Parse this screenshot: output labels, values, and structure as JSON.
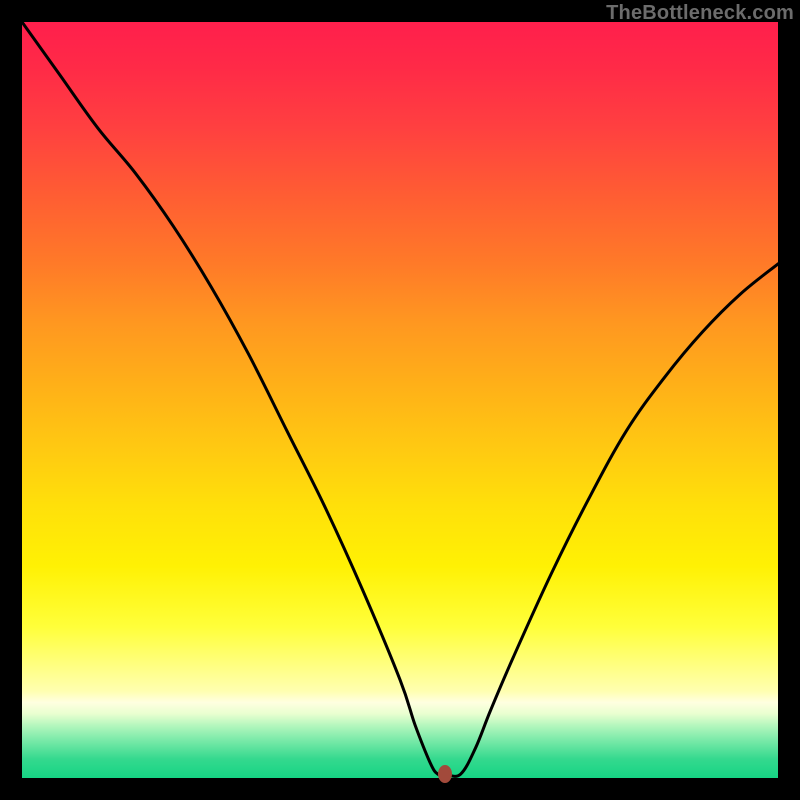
{
  "watermark": "TheBottleneck.com",
  "colors": {
    "frame": "#000000",
    "curve": "#000000",
    "marker": "#a24a3b",
    "gradient_top": "#ff1f4c",
    "gradient_bottom": "#16d484"
  },
  "chart_data": {
    "type": "line",
    "title": "",
    "xlabel": "",
    "ylabel": "",
    "xlim": [
      0,
      100
    ],
    "ylim": [
      0,
      100
    ],
    "grid": false,
    "legend": false,
    "series": [
      {
        "name": "bottleneck-curve",
        "x": [
          0,
          5,
          10,
          15,
          20,
          25,
          30,
          35,
          40,
          45,
          50,
          52,
          54,
          55,
          56,
          58,
          60,
          62,
          65,
          70,
          75,
          80,
          85,
          90,
          95,
          100
        ],
        "y": [
          100,
          93,
          86,
          80,
          73,
          65,
          56,
          46,
          36,
          25,
          13,
          7,
          2,
          0.5,
          0.5,
          0.5,
          4,
          9,
          16,
          27,
          37,
          46,
          53,
          59,
          64,
          68
        ]
      }
    ],
    "annotations": [
      {
        "name": "optimal-point",
        "x": 56,
        "y": 0.5
      }
    ]
  }
}
